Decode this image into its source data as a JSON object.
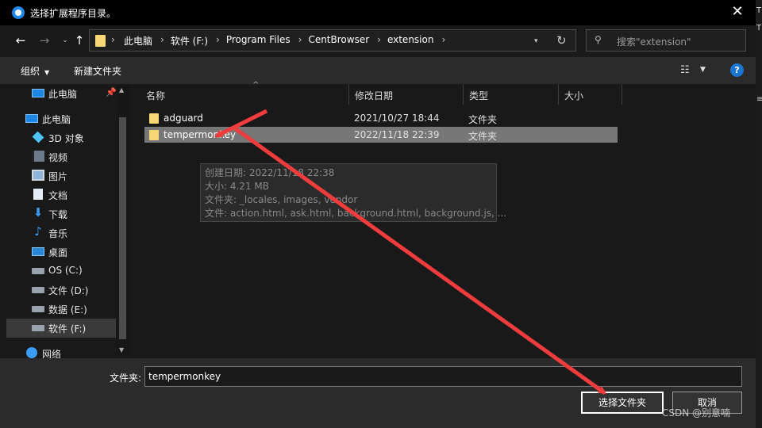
{
  "window": {
    "title": "选择扩展程序目录。",
    "close_glyph": "✕"
  },
  "nav": {
    "back": "←",
    "forward": "→",
    "recent": "⌄",
    "up": "↑"
  },
  "address": {
    "crumbs": [
      "此电脑",
      "软件 (F:)",
      "Program Files",
      "CentBrowser",
      "extension"
    ]
  },
  "search": {
    "placeholder": "搜索\"extension\""
  },
  "toolbar": {
    "organize": "组织",
    "new_folder": "新建文件夹",
    "help": "?"
  },
  "sidebar": {
    "pinned": "此电脑",
    "items": [
      {
        "label": "此电脑",
        "icon": "computer-icon"
      },
      {
        "label": "3D 对象",
        "icon": "3d-objects-icon"
      },
      {
        "label": "视频",
        "icon": "video-icon"
      },
      {
        "label": "图片",
        "icon": "pictures-icon"
      },
      {
        "label": "文档",
        "icon": "documents-icon"
      },
      {
        "label": "下载",
        "icon": "download-icon"
      },
      {
        "label": "音乐",
        "icon": "music-icon"
      },
      {
        "label": "桌面",
        "icon": "desktop-icon"
      },
      {
        "label": "OS (C:)",
        "icon": "drive-icon"
      },
      {
        "label": "文件 (D:)",
        "icon": "drive-icon"
      },
      {
        "label": "数据 (E:)",
        "icon": "drive-icon"
      },
      {
        "label": "软件 (F:)",
        "icon": "drive-icon"
      },
      {
        "label": "网络",
        "icon": "network-icon"
      }
    ]
  },
  "files": {
    "columns": [
      "名称",
      "修改日期",
      "类型",
      "大小"
    ],
    "rows": [
      {
        "name": "adguard",
        "date": "2021/10/27 18:44",
        "type": "文件夹"
      },
      {
        "name": "tempermonkey",
        "date": "2022/11/18 22:39",
        "type": "文件夹"
      }
    ]
  },
  "tooltip": {
    "created": "创建日期: 2022/11/18 22:38",
    "size": "大小: 4.21 MB",
    "folders": "文件夹: _locales, images, vendor",
    "files": "文件: action.html, ask.html, background.html, background.js, ..."
  },
  "footer": {
    "filename_label": "文件夹:",
    "filename_value": "tempermonkey",
    "ok": "选择文件夹",
    "cancel": "取消"
  },
  "watermark": "CSDN @别意喃",
  "colors": {
    "annotation_arrow": "#f03c3c",
    "selection": "#777777",
    "folder": "#f8d775"
  }
}
